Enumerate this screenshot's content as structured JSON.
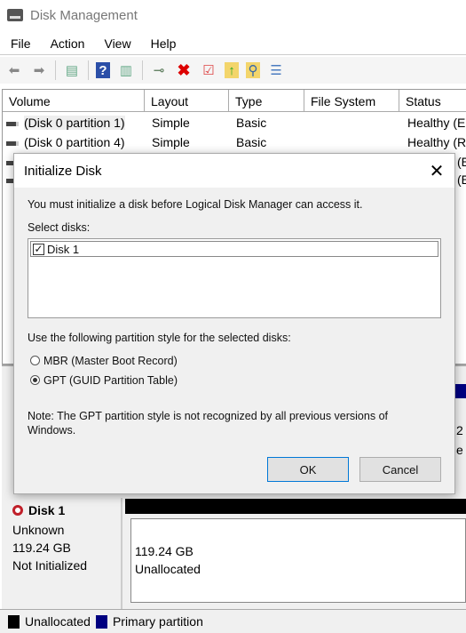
{
  "window": {
    "title": "Disk Management"
  },
  "menu": [
    "File",
    "Action",
    "View",
    "Help"
  ],
  "toolbar": {
    "icons": [
      "back-arrow-icon",
      "forward-arrow-icon",
      "console-tree-icon",
      "help-icon",
      "action-pane-icon",
      "connect-drive-icon",
      "delete-icon",
      "properties-icon",
      "folder-up-icon",
      "folder-search-icon",
      "settings-list-icon"
    ]
  },
  "volume_list": {
    "columns": [
      "Volume",
      "Layout",
      "Type",
      "File System",
      "Status"
    ],
    "rows": [
      {
        "volume": "(Disk 0 partition 1)",
        "layout": "Simple",
        "type": "Basic",
        "fs": "",
        "status": "Healthy (E"
      },
      {
        "volume": "(Disk 0 partition 4)",
        "layout": "Simple",
        "type": "Basic",
        "fs": "",
        "status": "Healthy (R"
      },
      {
        "volume": "",
        "layout": "",
        "type": "",
        "fs": "",
        "status": "(E"
      },
      {
        "volume": "",
        "layout": "",
        "type": "",
        "fs": "",
        "status": "(E"
      }
    ]
  },
  "dialog": {
    "title": "Initialize Disk",
    "intro": "You must initialize a disk before Logical Disk Manager can access it.",
    "select_label": "Select disks:",
    "disks": [
      {
        "label": "Disk 1",
        "checked": true
      }
    ],
    "style_label": "Use the following partition style for the selected disks:",
    "options": [
      {
        "label": "MBR (Master Boot Record)",
        "selected": false
      },
      {
        "label": "GPT (GUID Partition Table)",
        "selected": true
      }
    ],
    "note": "Note: The GPT partition style is not recognized by all previous versions of Windows.",
    "ok": "OK",
    "cancel": "Cancel"
  },
  "disk_panel": {
    "name": "Disk 1",
    "kind": "Unknown",
    "size": "119.24 GB",
    "state": "Not Initialized",
    "partition": {
      "size": "119.24 GB",
      "label": "Unallocated"
    },
    "behind_text": [
      "2",
      "e"
    ]
  },
  "legend": [
    {
      "label": "Unallocated",
      "color": "#000000"
    },
    {
      "label": "Primary partition",
      "color": "#000080"
    }
  ],
  "colors": {
    "primary": "#000080",
    "unallocated": "#000000",
    "ok_border": "#0078d7"
  }
}
